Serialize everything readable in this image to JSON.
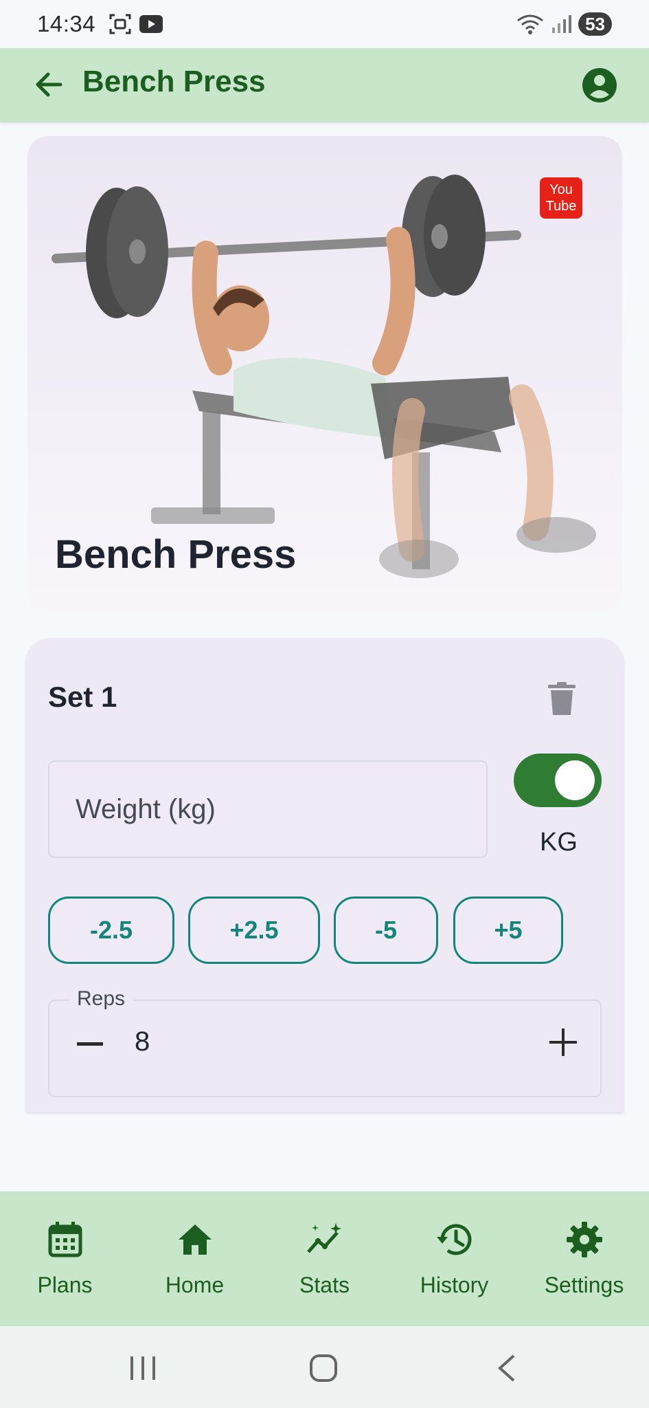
{
  "status": {
    "time": "14:34",
    "battery": "53"
  },
  "appbar": {
    "title": "Bench Press"
  },
  "hero": {
    "exercise_name": "Bench Press",
    "youtube_text_1": "You",
    "youtube_text_2": "Tube"
  },
  "set": {
    "title": "Set 1",
    "weight_placeholder": "Weight (kg)",
    "unit_label": "KG",
    "unit_toggle_on": true,
    "chips": [
      "-2.5",
      "+2.5",
      "-5",
      "+5"
    ],
    "reps_label": "Reps",
    "reps_value": "8"
  },
  "nav": {
    "items": [
      {
        "label": "Plans",
        "icon": "calendar-icon"
      },
      {
        "label": "Home",
        "icon": "home-icon"
      },
      {
        "label": "Stats",
        "icon": "stats-icon"
      },
      {
        "label": "History",
        "icon": "history-icon"
      },
      {
        "label": "Settings",
        "icon": "gear-icon"
      }
    ]
  },
  "colors": {
    "appbar_bg": "#c8e6c9",
    "primary_green": "#1b5e20",
    "toggle_green": "#2e7d32",
    "chip_teal": "#12867a",
    "card_bg": "#eeeaf5"
  }
}
